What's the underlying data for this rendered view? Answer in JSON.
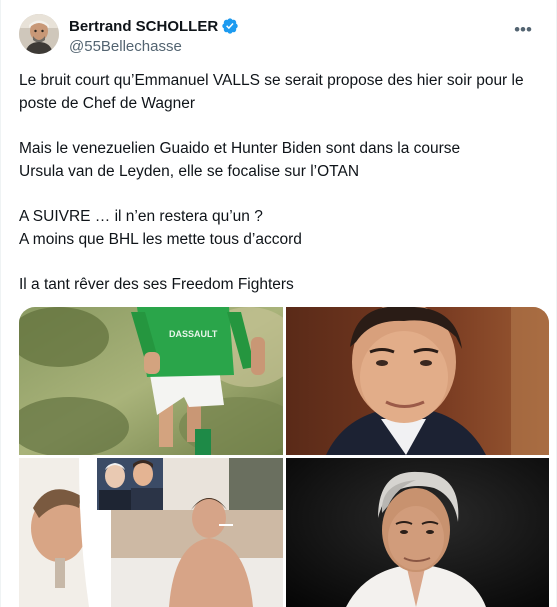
{
  "post": {
    "author": {
      "display_name": "Bertrand SCHOLLER",
      "handle": "@55Bellechasse",
      "verified": true
    },
    "more_icon": "more-horizontal-icon",
    "text_lines": [
      "Le bruit court qu’Emmanuel VALLS se serait propose des hier soir pour le poste de Chef de Wagner",
      "Mais le venezuelien Guaido et Hunter Biden sont dans la course",
      "Ursula van de Leyden, elle se focalise sur l’OTAN",
      "A SUIVRE … il n’en restera qu’un ?",
      "A moins que BHL les mette tous d’accord",
      "Il a tant rêver des ses Freedom Fighters"
    ],
    "media": {
      "count": 4,
      "photo_1_shirt_text": "DASSAULT"
    }
  },
  "colors": {
    "text": "#0f1419",
    "secondary": "#536471",
    "verified": "#1d9bf0",
    "border": "#eff3f4"
  }
}
